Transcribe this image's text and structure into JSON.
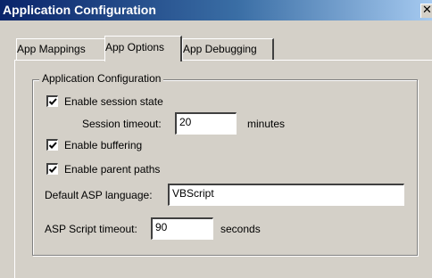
{
  "window": {
    "title": "Application Configuration",
    "close_glyph": "✕"
  },
  "tabs": [
    {
      "label": "App Mappings",
      "selected": false
    },
    {
      "label": "App Options",
      "selected": true
    },
    {
      "label": "App Debugging",
      "selected": false
    }
  ],
  "group": {
    "title": "Application Configuration"
  },
  "session_state": {
    "label": "Enable session state",
    "checked": true
  },
  "session_timeout": {
    "label": "Session timeout:",
    "value": "20",
    "unit": "minutes"
  },
  "buffering": {
    "label": "Enable buffering",
    "checked": true
  },
  "parent_paths": {
    "label": "Enable parent paths",
    "checked": true
  },
  "asp_language": {
    "label": "Default ASP language:",
    "value": "VBScript"
  },
  "script_timeout": {
    "label": "ASP Script timeout:",
    "value": "90",
    "unit": "seconds"
  },
  "colors": {
    "title_start": "#0a246a",
    "title_end": "#a6caf0",
    "dialog_face": "#d4d0c8"
  }
}
